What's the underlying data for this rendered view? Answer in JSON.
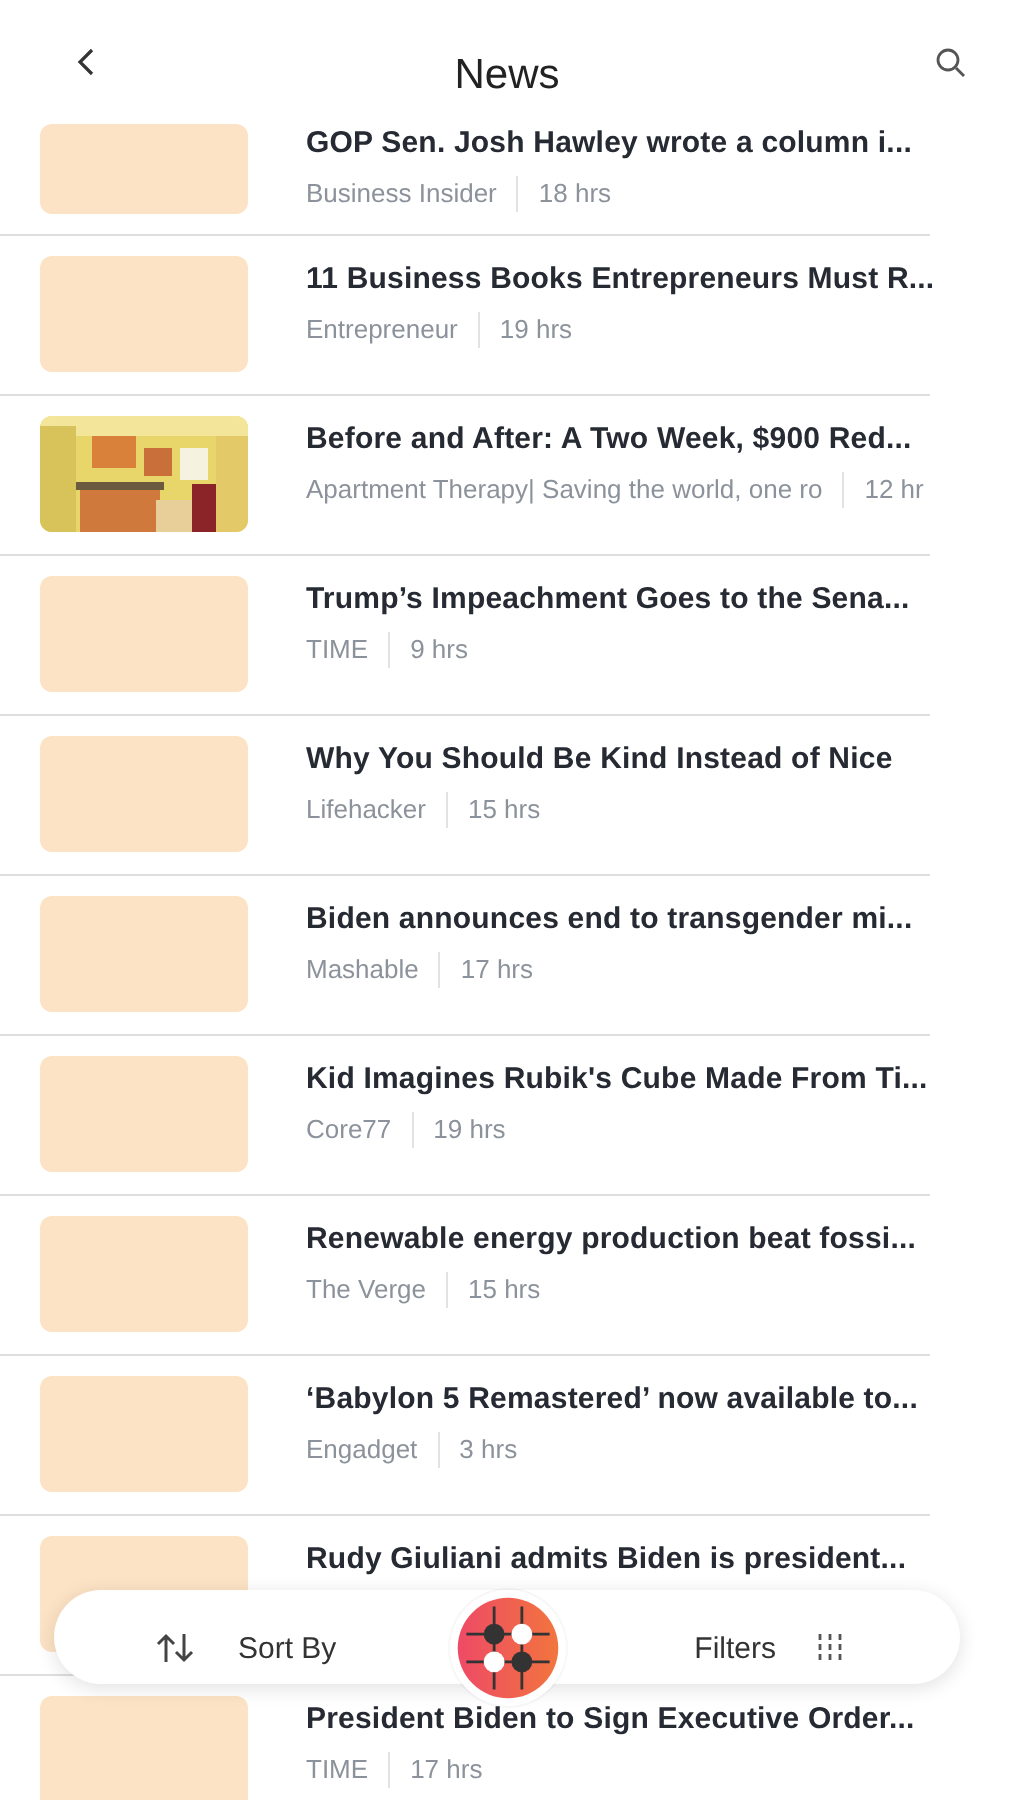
{
  "header": {
    "title": "News"
  },
  "articles": [
    {
      "title": "GOP Sen. Josh Hawley wrote a column i...",
      "source": "Business Insider",
      "time": "18 hrs",
      "thumbnail": {
        "kind": "placeholder"
      },
      "partial": true
    },
    {
      "title": "11 Business Books Entrepreneurs Must R...",
      "source": "Entrepreneur",
      "time": "19 hrs",
      "thumbnail": {
        "kind": "placeholder"
      }
    },
    {
      "title": "Before and After: A Two Week, $900 Red...",
      "source": "Apartment Therapy| Saving the world, one ro",
      "time": "12 hr"
    },
    {
      "title": "Trump’s Impeachment Goes to the Sena...",
      "source": "TIME",
      "time": "9 hrs",
      "thumbnail": {
        "kind": "placeholder"
      }
    },
    {
      "title": "Why You Should Be Kind Instead of Nice",
      "source": "Lifehacker",
      "time": "15 hrs",
      "thumbnail": {
        "kind": "placeholder"
      }
    },
    {
      "title": "Biden announces end to transgender mi...",
      "source": "Mashable",
      "time": "17 hrs",
      "thumbnail": {
        "kind": "placeholder"
      }
    },
    {
      "title": "Kid Imagines Rubik's Cube Made From Ti...",
      "source": "Core77",
      "time": "19 hrs",
      "thumbnail": {
        "kind": "placeholder"
      }
    },
    {
      "title": "Renewable energy production beat fossi...",
      "source": "The Verge",
      "time": "15 hrs",
      "thumbnail": {
        "kind": "placeholder"
      }
    },
    {
      "title": "‘Babylon 5 Remastered’ now available to...",
      "source": "Engadget",
      "time": "3 hrs",
      "thumbnail": {
        "kind": "placeholder"
      }
    },
    {
      "title": "Rudy Giuliani admits Biden is president...",
      "thumbnail": {
        "kind": "placeholder"
      }
    },
    {
      "title": "President Biden to Sign Executive Order...",
      "source": "TIME",
      "time": "17 hrs",
      "thumbnail": {
        "kind": "placeholder"
      }
    }
  ],
  "toolbar": {
    "sort_label": "Sort By",
    "filters_label": "Filters"
  }
}
